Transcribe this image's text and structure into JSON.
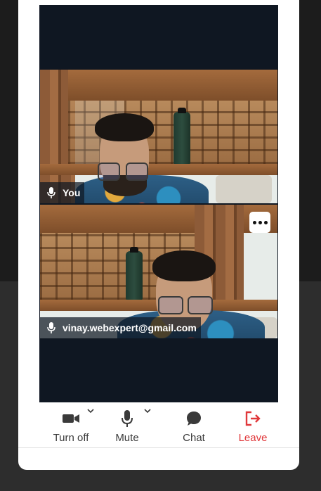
{
  "tiles": [
    {
      "participant": "You",
      "mic_icon": "microphone-icon"
    },
    {
      "participant": "vinay.webexpert@gmail.com",
      "mic_icon": "microphone-icon",
      "more_icon": "more-options-icon"
    }
  ],
  "controls": {
    "camera": {
      "label": "Turn off",
      "icon": "video-camera-icon"
    },
    "mic": {
      "label": "Mute",
      "icon": "microphone-icon"
    },
    "chat": {
      "label": "Chat",
      "icon": "chat-bubble-icon"
    },
    "leave": {
      "label": "Leave",
      "icon": "leave-icon",
      "color": "#e0383b"
    }
  },
  "colors": {
    "stage": "#0f1722",
    "accent": "#2ea36b"
  }
}
